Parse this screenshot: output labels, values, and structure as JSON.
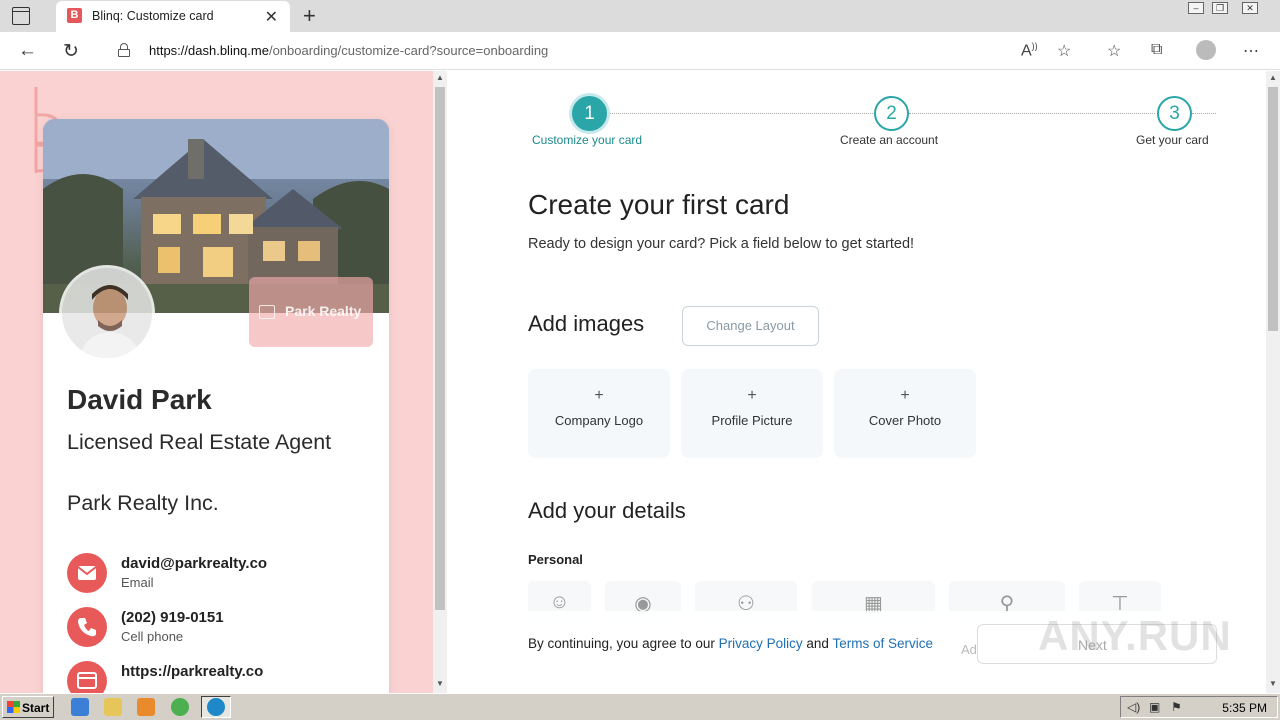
{
  "browser": {
    "tab_title": "Blinq: Customize card",
    "tab_favicon_letter": "B",
    "url_host": "https://dash.blinq.me",
    "url_path": "/onboarding/customize-card?source=onboarding",
    "new_tab_glyph": "+",
    "close_glyph": "✕"
  },
  "card": {
    "name": "David Park",
    "title": "Licensed Real Estate Agent",
    "company": "Park Realty Inc.",
    "logo_placeholder": "Park Realty",
    "contacts": [
      {
        "value": "david@parkrealty.co",
        "label": "Email",
        "icon": "email-icon"
      },
      {
        "value": "(202) 919-0151",
        "label": "Cell phone",
        "icon": "phone-icon"
      },
      {
        "value": "https://parkrealty.co",
        "label": "",
        "icon": "website-icon"
      }
    ]
  },
  "steps": [
    {
      "number": "1",
      "label": "Customize your card",
      "active": true
    },
    {
      "number": "2",
      "label": "Create an account",
      "active": false
    },
    {
      "number": "3",
      "label": "Get your card",
      "active": false
    }
  ],
  "main": {
    "heading": "Create your first card",
    "subtitle": "Ready to design your card? Pick a field below to get started!",
    "images_heading": "Add images",
    "change_layout": "Change Layout",
    "image_tiles": [
      "Company Logo",
      "Profile Picture",
      "Cover Photo"
    ],
    "plus_glyph": "+",
    "details_heading": "Add your details",
    "personal_label": "Personal",
    "legal_prefix": "By continuing, you agree to our ",
    "privacy": "Privacy Policy",
    "and": " and ",
    "terms": "Terms of Service",
    "next": "Next",
    "ad_partial": "Ad"
  },
  "watermark": "ANY.RUN",
  "taskbar": {
    "start": "Start",
    "clock": "5:35 PM"
  },
  "colors": {
    "accent": "#2aa6a8",
    "brand_pink": "#fad2d2",
    "contact_red": "#e85a5a",
    "link_blue": "#1f6fb3"
  }
}
